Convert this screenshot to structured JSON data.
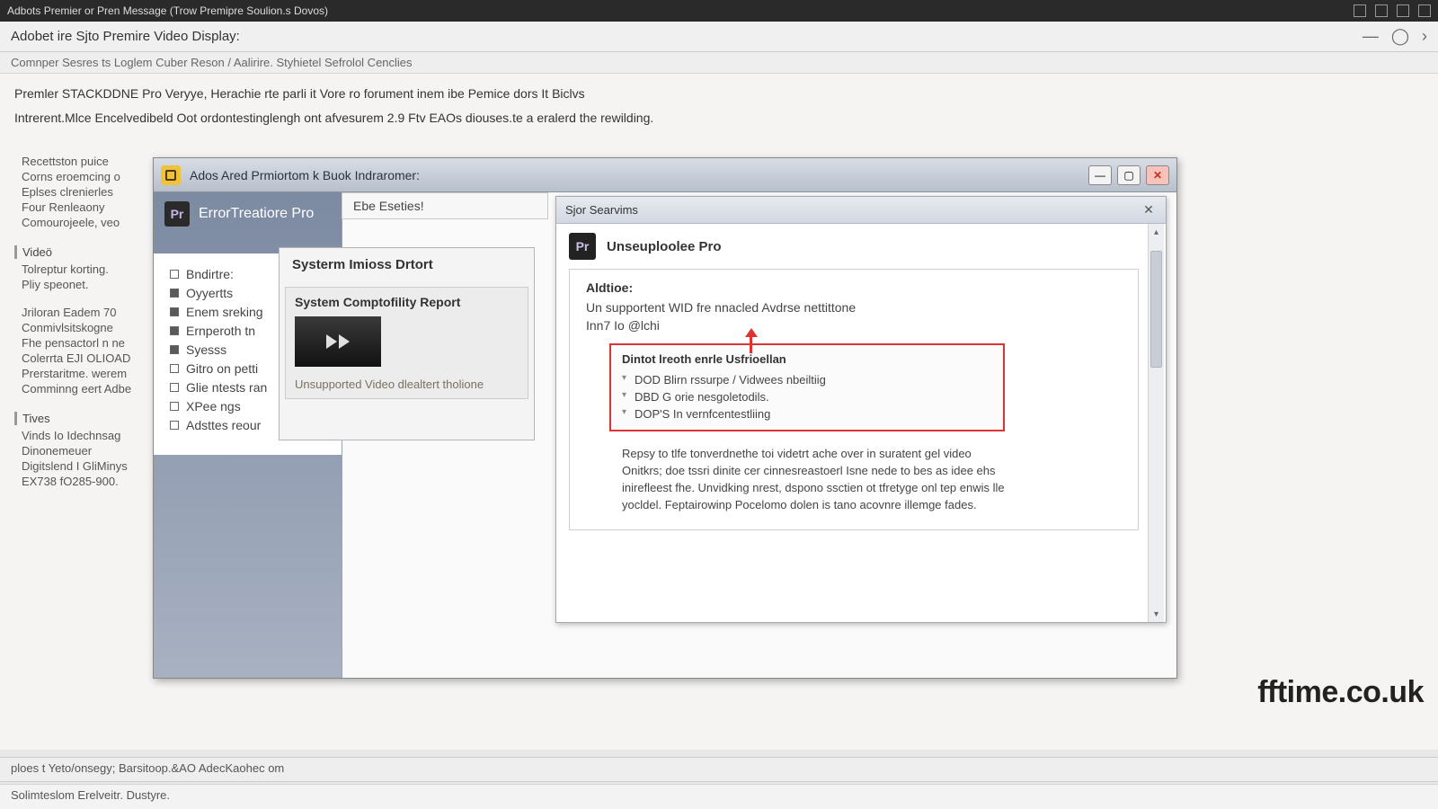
{
  "top_titlebar": "Adbots Premier or Pren Message (Trow Premipre Soulion.s Dovos)",
  "browser_title": "Adobet ire Sjto Premire Video Display:",
  "breadcrumb": "Comnper Sesres ts Loglem Cuber Reson / Aalirire. Styhietel Sefrolol Cenclies",
  "bg": {
    "p1": "Premler STACKDDNE Pro Veryye, Herachie rte parli it Vore ro forument inem ibe Pemice dors It Biclvs",
    "p2": "Intrerent.Mlce Encelvedibeld Oot ordontestinglengh ont afvesurem 2.9 Ftv EAOs diouses.te a eralerd the rewilding."
  },
  "bg_sidebar": {
    "s1": [
      "Recettston puice",
      "Corns eroemcing o",
      "Eplses clrenierles",
      "Four Renleaony",
      "Comourojeele, veo"
    ],
    "video_hdr": "Videö",
    "s2": [
      "Tolreptur korting.",
      "Pliy speonet."
    ],
    "s3": [
      "Jriloran Eadem 70",
      "Conmivlsitskogne",
      "Fhe pensactorl n ne",
      "Colerrta EJI OLIOAD",
      "Prerstaritme. werem",
      "Comminng eert Adbe"
    ],
    "tives_hdr": "Tives",
    "s4": [
      "Vinds Io Idechnsag",
      "Dinonemeuer",
      "Digitslend I GliMinys",
      "EX738 fO285-900."
    ]
  },
  "dialog": {
    "title": "Ados Ared Prmiortom k Buok Indraromer:",
    "left_header": "ErrorTreatiore Pro",
    "left_items": [
      {
        "label": "Bndirtre:",
        "filled": false
      },
      {
        "label": "Oyyertts",
        "filled": true
      },
      {
        "label": "Enem sreking",
        "filled": true
      },
      {
        "label": "Ernperoth tn",
        "filled": true
      },
      {
        "label": "Syesss",
        "filled": true
      },
      {
        "label": "Gitro on petti",
        "filled": false
      },
      {
        "label": "Glie ntests ran",
        "filled": false
      },
      {
        "label": "XPee ngs",
        "filled": false
      },
      {
        "label": "Adsttes reour",
        "filled": false
      }
    ]
  },
  "tab_label": "Ebe Eseties!",
  "mid_panel": {
    "title": "Systerm Imioss Drtort",
    "sub_title": "System Comptofility Report",
    "caption": "Unsupported Video dlealtert tholione"
  },
  "popup": {
    "title": "Sjor Searvims",
    "header": "Unseuploolee Pro",
    "alabel": "Aldtioe:",
    "aline1": "Un supportent WID fre nnacled Avdrse nettittone",
    "aline2": "Inn7 Io @lchi",
    "red_title": "Dintot lreoth enrle Usfrioellan",
    "red_items": [
      "DOD Blirn rssurpe / Vidwees nbeiltiig",
      "DBD G orie nesgoletodils.",
      "DOP'S In vernfcentestliing"
    ],
    "para": "Repsy to tlfe tonverdnethe toi videtrt ache over in suratent gel video Onitkrs; doe tssri dinite cer cinnesreastoerl Isne nede to bes as idee ehs inirefleest fhe. Unvidking nrest, dspono ssctien ot tfretyge onl tep enwis lle yocldel. Feptairowinp Pocelomo dolen is tano acovnre illemge fades."
  },
  "watermark": "fftime.co.uk",
  "status1": "ploes t Yeto/onsegy; Barsitoop.&AO AdecKaohec om",
  "status2": "Solimteslom Erelveitr. Dustyre."
}
